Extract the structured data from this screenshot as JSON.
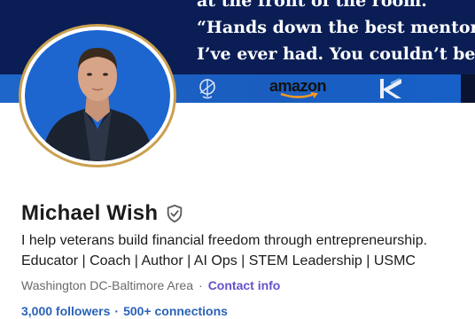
{
  "banner": {
    "quote_line1": "at the front of the room.",
    "quote_line2": "“Hands down the best mentor an",
    "quote_line3": "I’ve ever had. You couldn’t be in",
    "logos": [
      "usmc-emblem-icon",
      "amazon-logo-icon",
      "k-logo-icon"
    ],
    "amazon_text": "amazon"
  },
  "profile": {
    "name": "Michael Wish",
    "verified_icon": "verified-shield-icon",
    "headline_line1": "I help veterans build financial freedom through entrepreneurship.",
    "headline_line2": "Educator | Coach | Author | AI Ops | STEM Leadership | USMC",
    "location": "Washington DC-Baltimore Area",
    "separator": "·",
    "contact_info_label": "Contact info",
    "followers": "3,000 followers",
    "connections": "500+ connections"
  },
  "colors": {
    "banner_dark": "#0a1e55",
    "banner_strip": "#1e66c9",
    "avatar_bg": "#1d66d0",
    "avatar_ring": "#caa04f",
    "link_purple": "#6552c8",
    "link_blue": "#2a63b8"
  }
}
